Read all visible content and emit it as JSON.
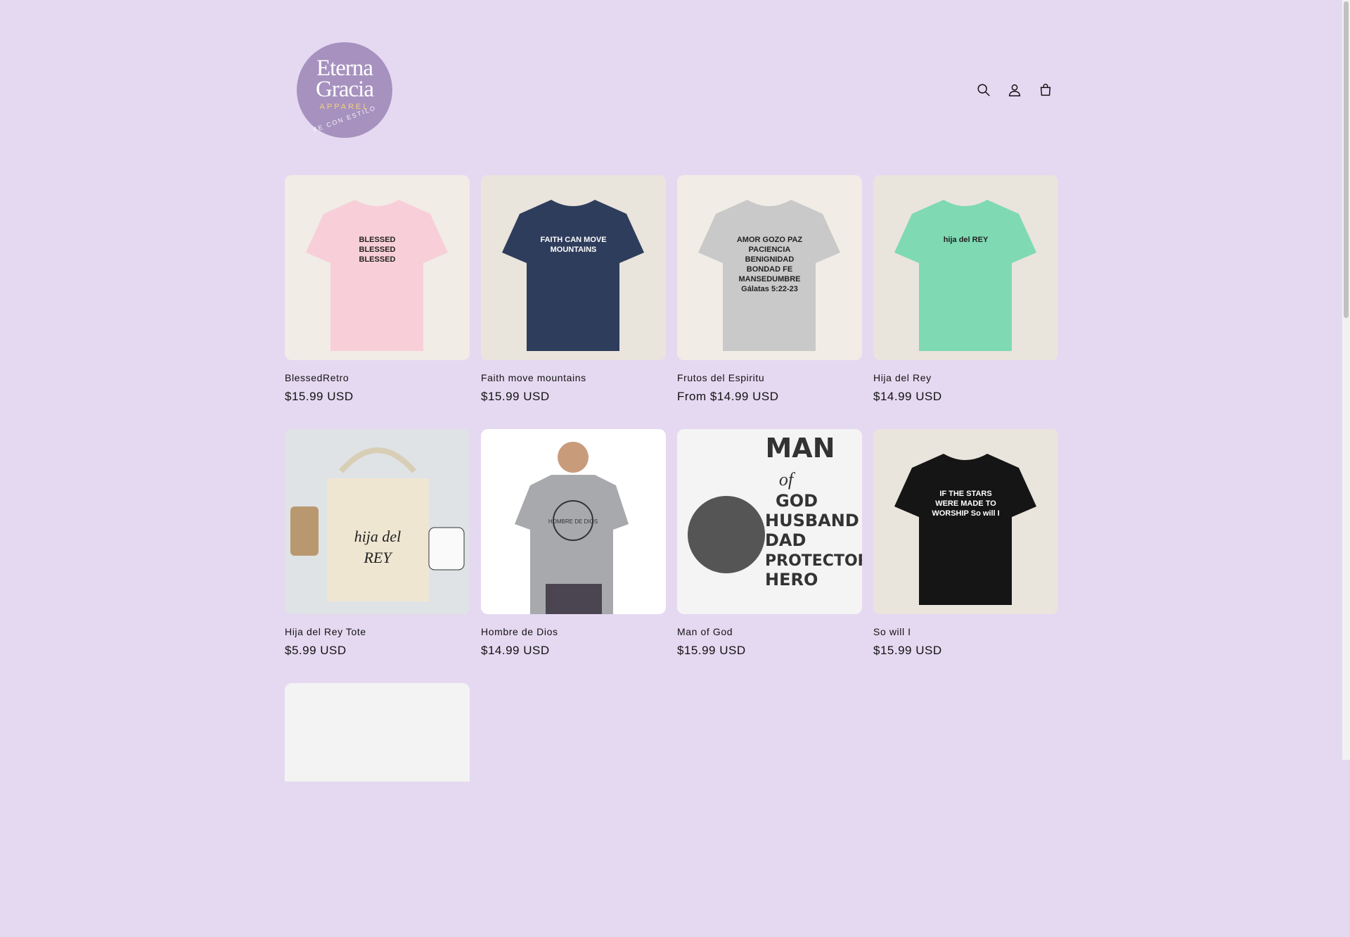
{
  "brand": {
    "line1": "Eterna",
    "line2": "Gracia",
    "line3": "APPAREL",
    "line4": "FE CON ESTILO"
  },
  "header": {
    "icons": [
      "search-icon",
      "account-icon",
      "cart-icon"
    ]
  },
  "products": [
    {
      "name": "BlessedRetro",
      "price": "$15.99 USD",
      "art": "BLESSED BLESSED BLESSED",
      "shirt_color": "#f8cfd9"
    },
    {
      "name": "Faith move mountains",
      "price": "$15.99 USD",
      "art": "FAITH CAN MOVE MOUNTAINS",
      "shirt_color": "#2f3d5c"
    },
    {
      "name": "Frutos del Espiritu",
      "price": "From $14.99 USD",
      "art": "AMOR GOZO PAZ PACIENCIA BENIGNIDAD BONDAD FE MANSEDUMBRE Gálatas 5:22-23",
      "shirt_color": "#c9c9c9"
    },
    {
      "name": "Hija del Rey",
      "price": "$14.99 USD",
      "art": "hija del REY",
      "shirt_color": "#7fd9b3"
    },
    {
      "name": "Hija del Rey Tote",
      "price": "$5.99 USD",
      "art": "hija del REY",
      "shirt_color": "#efe6d2"
    },
    {
      "name": "Hombre de Dios",
      "price": "$14.99 USD",
      "art": "HOMBRE DE DIOS",
      "shirt_color": "#a7a9ad"
    },
    {
      "name": "Man of God",
      "price": "$15.99 USD",
      "art": "MAN of GOD HUSBAND DAD PROTECTOR HERO",
      "shirt_color": "#f4f4f4"
    },
    {
      "name": "So will I",
      "price": "$15.99 USD",
      "art": "IF THE STARS WERE MADE TO WORSHIP So will I",
      "shirt_color": "#151515"
    }
  ]
}
